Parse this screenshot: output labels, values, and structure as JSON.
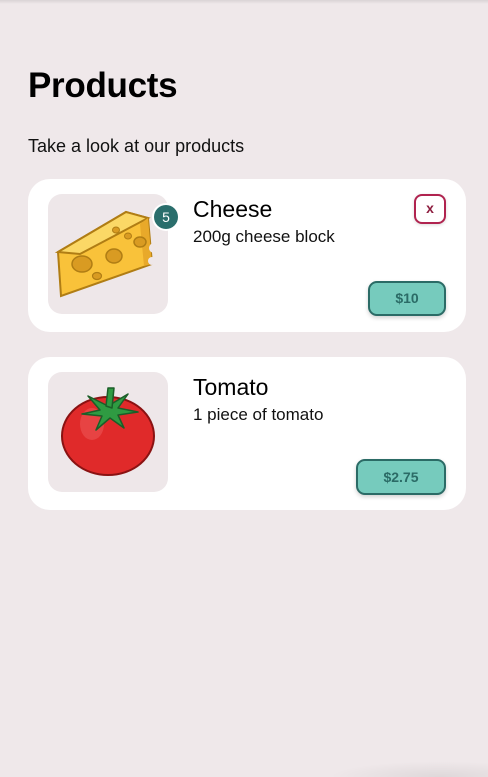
{
  "header": {
    "title": "Products",
    "subtitle": "Take a look at our products"
  },
  "products": [
    {
      "name": "Cheese",
      "description": "200g cheese block",
      "price": "$10",
      "quantity": "5",
      "remove_label": "x",
      "icon": "cheese-icon"
    },
    {
      "name": "Tomato",
      "description": "1 piece of tomato",
      "price": "$2.75",
      "icon": "tomato-icon"
    }
  ],
  "colors": {
    "background": "#efe8ea",
    "card": "#ffffff",
    "price_button": "#76cbbd",
    "price_border": "#2b6b66",
    "badge": "#2a6e6c",
    "remove_border": "#b0234f"
  }
}
